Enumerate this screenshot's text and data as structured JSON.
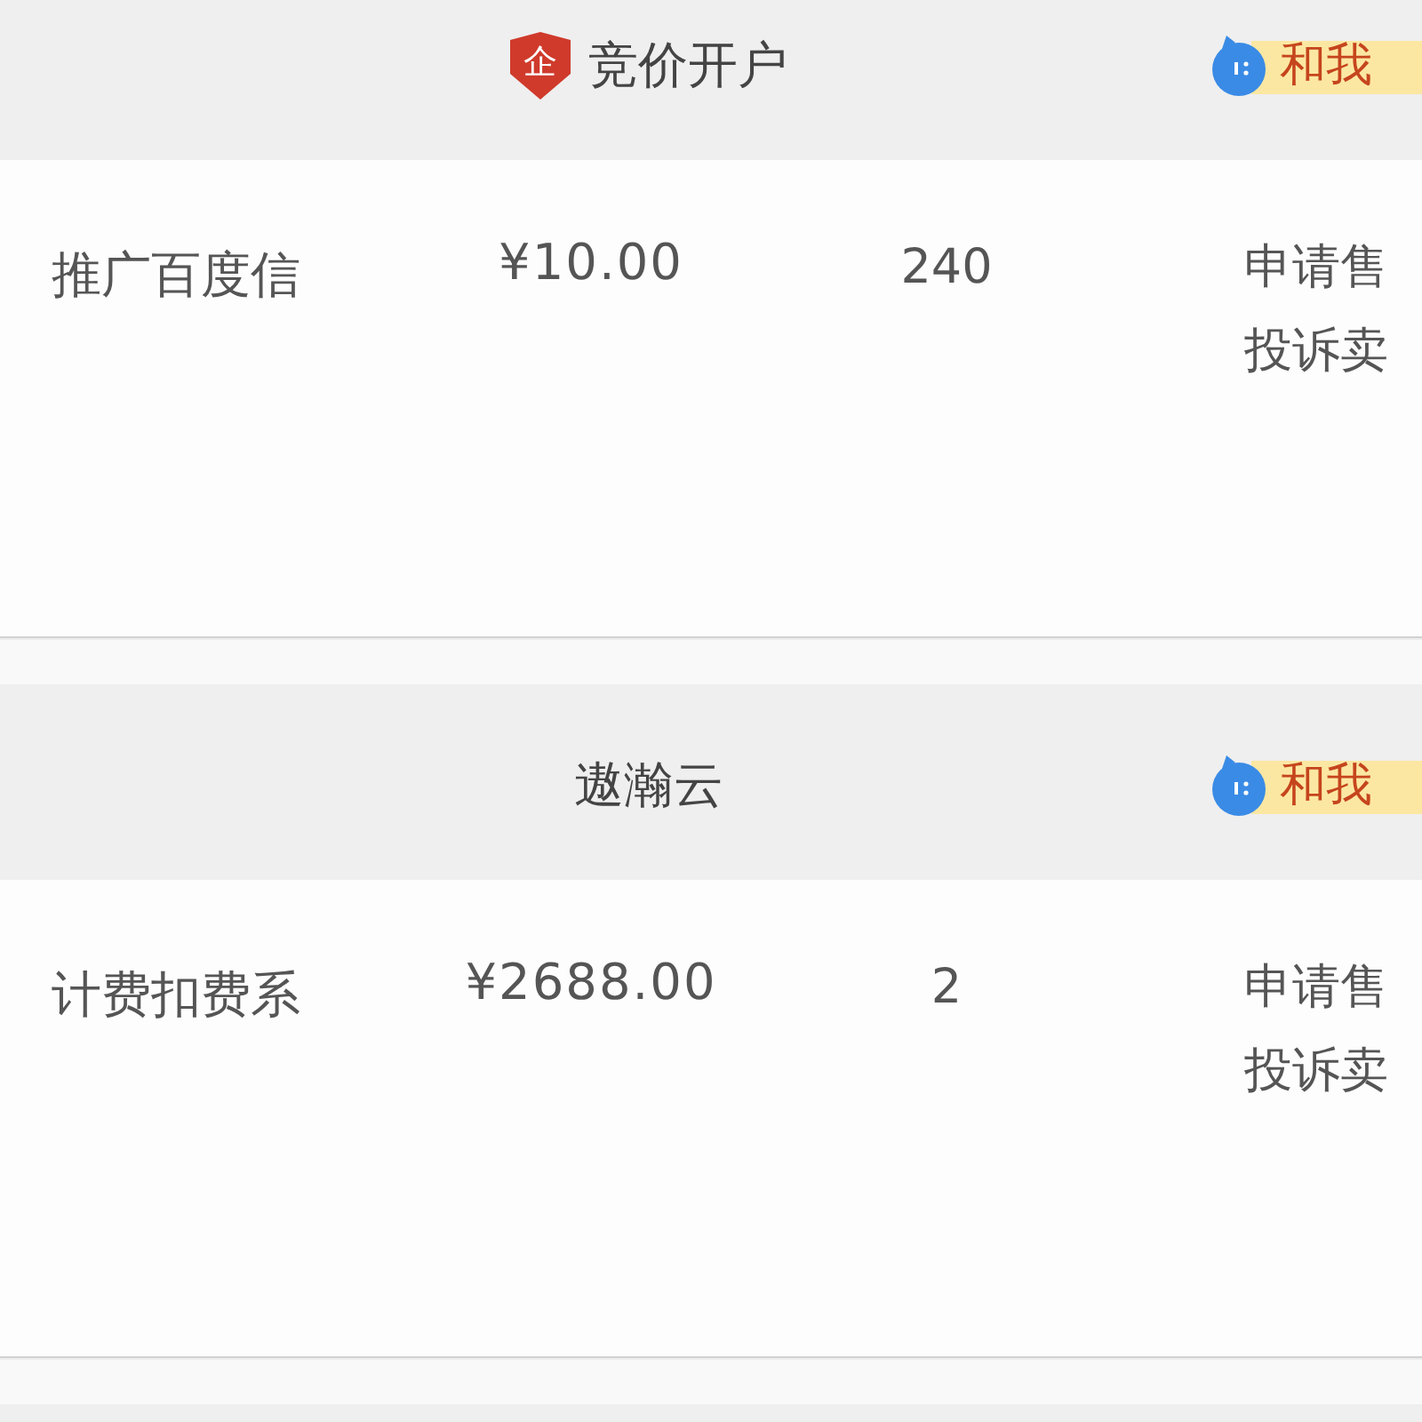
{
  "orders": [
    {
      "shop": {
        "badge": "企",
        "name": "竞价开户"
      },
      "contact_button": {
        "label": "和我"
      },
      "item": {
        "name": "推广百度信",
        "price": "¥10.00",
        "quantity": "240"
      },
      "actions": [
        "申请售",
        "投诉卖"
      ]
    },
    {
      "shop": {
        "name": "遨瀚云"
      },
      "contact_button": {
        "label": "和我"
      },
      "item": {
        "name": "计费扣费系",
        "price": "¥2688.00",
        "quantity": "2"
      },
      "actions": [
        "申请售",
        "投诉卖"
      ]
    }
  ]
}
